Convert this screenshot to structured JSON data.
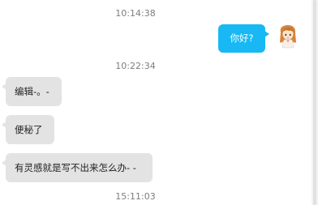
{
  "messages": [
    {
      "timestamp": "10:14:38"
    },
    {
      "direction": "outgoing",
      "text": "你好?"
    },
    {
      "timestamp": "10:22:34"
    },
    {
      "direction": "incoming",
      "text": "编辑-。-"
    },
    {
      "direction": "incoming",
      "text": "便秘了"
    },
    {
      "direction": "incoming",
      "text": "有灵感就是写不出来怎么办- -"
    },
    {
      "timestamp": "15:11:03"
    }
  ],
  "colors": {
    "outgoing_bubble": "#17b8f3",
    "incoming_bubble": "#e3e3e3",
    "timestamp_text": "#7d7d7d"
  },
  "icons": {
    "sender_avatar": "anime-girl-avatar-icon"
  }
}
